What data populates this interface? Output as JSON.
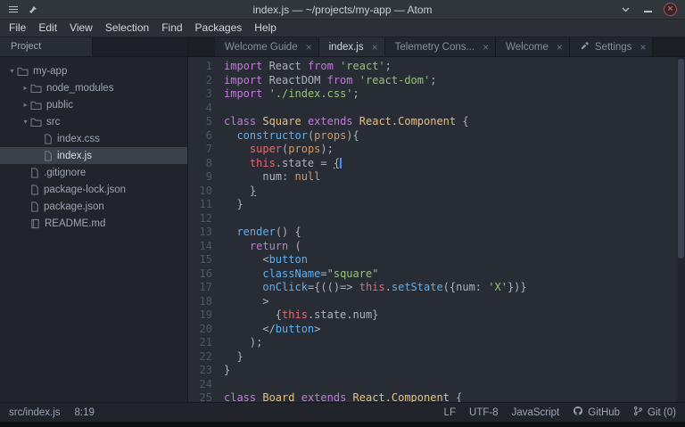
{
  "titlebar": {
    "title": "index.js — ~/projects/my-app — Atom",
    "left_icons": [
      "window-menu-icon",
      "pin-icon"
    ],
    "right_icons": [
      "shade-icon",
      "minimize-icon",
      "close-icon"
    ]
  },
  "menu": {
    "items": [
      "File",
      "Edit",
      "View",
      "Selection",
      "Find",
      "Packages",
      "Help"
    ]
  },
  "tree": {
    "header": "Project",
    "items": [
      {
        "label": "my-app",
        "type": "folder",
        "expanded": true,
        "indent": 0,
        "icon": "folder-icon"
      },
      {
        "label": "node_modules",
        "type": "folder",
        "expanded": false,
        "indent": 1,
        "icon": "folder-icon"
      },
      {
        "label": "public",
        "type": "folder",
        "expanded": false,
        "indent": 1,
        "icon": "folder-icon"
      },
      {
        "label": "src",
        "type": "folder",
        "expanded": true,
        "indent": 1,
        "icon": "folder-icon"
      },
      {
        "label": "index.css",
        "type": "file",
        "indent": 2,
        "icon": "file-icon"
      },
      {
        "label": "index.js",
        "type": "file",
        "indent": 2,
        "icon": "file-icon",
        "selected": true
      },
      {
        "label": ".gitignore",
        "type": "file",
        "indent": 1,
        "icon": "file-icon"
      },
      {
        "label": "package-lock.json",
        "type": "file",
        "indent": 1,
        "icon": "file-icon"
      },
      {
        "label": "package.json",
        "type": "file",
        "indent": 1,
        "icon": "file-icon"
      },
      {
        "label": "README.md",
        "type": "file",
        "indent": 1,
        "icon": "book-icon"
      }
    ]
  },
  "tabs": [
    {
      "label": "Welcome Guide",
      "active": false
    },
    {
      "label": "index.js",
      "active": true
    },
    {
      "label": "Telemetry Cons...",
      "active": false
    },
    {
      "label": "Welcome",
      "active": false
    },
    {
      "label": "Settings",
      "active": false,
      "icon": "wrench-icon"
    }
  ],
  "colors": {
    "syntax": {
      "kw": "#c678dd",
      "str": "#98c379",
      "cls": "#e5c07b",
      "fn": "#61afef",
      "red": "#e06c75",
      "orn": "#d19a66",
      "pln": "#abb2bf"
    },
    "editor_bg": "#282c34",
    "panel_bg": "#21252b",
    "selection_bg": "#3a404c"
  },
  "editor": {
    "lines": [
      {
        "n": 1,
        "s": [
          {
            "t": "import",
            "c": "kw"
          },
          {
            "t": " React "
          },
          {
            "t": "from",
            "c": "kw"
          },
          {
            "t": " "
          },
          {
            "t": "'react'",
            "c": "str"
          },
          {
            "t": ";"
          }
        ]
      },
      {
        "n": 2,
        "s": [
          {
            "t": "import",
            "c": "kw"
          },
          {
            "t": " ReactDOM "
          },
          {
            "t": "from",
            "c": "kw"
          },
          {
            "t": " "
          },
          {
            "t": "'react-dom'",
            "c": "str"
          },
          {
            "t": ";"
          }
        ]
      },
      {
        "n": 3,
        "s": [
          {
            "t": "import",
            "c": "kw"
          },
          {
            "t": " "
          },
          {
            "t": "'./index.css'",
            "c": "str"
          },
          {
            "t": ";"
          }
        ]
      },
      {
        "n": 4,
        "s": []
      },
      {
        "n": 5,
        "s": [
          {
            "t": "class",
            "c": "kw"
          },
          {
            "t": " "
          },
          {
            "t": "Square",
            "c": "cls"
          },
          {
            "t": " "
          },
          {
            "t": "extends",
            "c": "kw"
          },
          {
            "t": " "
          },
          {
            "t": "React.Component",
            "c": "cls"
          },
          {
            "t": " {"
          }
        ]
      },
      {
        "n": 6,
        "s": [
          {
            "t": "  "
          },
          {
            "t": "constructor",
            "c": "fn"
          },
          {
            "t": "("
          },
          {
            "t": "props",
            "c": "orn"
          },
          {
            "t": "){"
          }
        ]
      },
      {
        "n": 7,
        "s": [
          {
            "t": "    "
          },
          {
            "t": "super",
            "c": "red"
          },
          {
            "t": "("
          },
          {
            "t": "props",
            "c": "orn"
          },
          {
            "t": ");"
          }
        ]
      },
      {
        "n": 8,
        "s": [
          {
            "t": "    "
          },
          {
            "t": "this",
            "c": "red"
          },
          {
            "t": ".state = "
          },
          {
            "t": "{",
            "u": true
          }
        ],
        "cursor": true
      },
      {
        "n": 9,
        "s": [
          {
            "t": "      num: "
          },
          {
            "t": "null",
            "c": "orn"
          }
        ]
      },
      {
        "n": 10,
        "s": [
          {
            "t": "    "
          },
          {
            "t": "}",
            "u": true
          }
        ]
      },
      {
        "n": 11,
        "s": [
          {
            "t": "  }"
          }
        ]
      },
      {
        "n": 12,
        "s": []
      },
      {
        "n": 13,
        "s": [
          {
            "t": "  "
          },
          {
            "t": "render",
            "c": "fn"
          },
          {
            "t": "() {"
          }
        ]
      },
      {
        "n": 14,
        "s": [
          {
            "t": "    "
          },
          {
            "t": "return",
            "c": "kw"
          },
          {
            "t": " ("
          }
        ]
      },
      {
        "n": 15,
        "s": [
          {
            "t": "      <"
          },
          {
            "t": "button",
            "c": "fn"
          }
        ]
      },
      {
        "n": 16,
        "s": [
          {
            "t": "      "
          },
          {
            "t": "className",
            "c": "fn"
          },
          {
            "t": "="
          },
          {
            "t": "\"square\"",
            "c": "str"
          }
        ]
      },
      {
        "n": 17,
        "s": [
          {
            "t": "      "
          },
          {
            "t": "onClick",
            "c": "fn"
          },
          {
            "t": "={(()=> "
          },
          {
            "t": "this",
            "c": "red"
          },
          {
            "t": "."
          },
          {
            "t": "setState",
            "c": "fn"
          },
          {
            "t": "({num: "
          },
          {
            "t": "'X'",
            "c": "str"
          },
          {
            "t": "})}"
          }
        ]
      },
      {
        "n": 18,
        "s": [
          {
            "t": "      >"
          }
        ]
      },
      {
        "n": 19,
        "s": [
          {
            "t": "        {"
          },
          {
            "t": "this",
            "c": "red"
          },
          {
            "t": ".state.num}"
          }
        ]
      },
      {
        "n": 20,
        "s": [
          {
            "t": "      </"
          },
          {
            "t": "button",
            "c": "fn"
          },
          {
            "t": ">"
          }
        ]
      },
      {
        "n": 21,
        "s": [
          {
            "t": "    );"
          }
        ]
      },
      {
        "n": 22,
        "s": [
          {
            "t": "  }"
          }
        ]
      },
      {
        "n": 23,
        "s": [
          {
            "t": "}"
          }
        ]
      },
      {
        "n": 24,
        "s": []
      },
      {
        "n": 25,
        "s": [
          {
            "t": "class",
            "c": "kw"
          },
          {
            "t": " "
          },
          {
            "t": "Board",
            "c": "cls"
          },
          {
            "t": " "
          },
          {
            "t": "extends",
            "c": "kw"
          },
          {
            "t": " "
          },
          {
            "t": "React.Component",
            "c": "cls"
          },
          {
            "t": " {"
          }
        ]
      }
    ]
  },
  "statusbar": {
    "file": "src/index.js",
    "position": "8:19",
    "line_ending": "LF",
    "encoding": "UTF-8",
    "grammar": "JavaScript",
    "github_label": "GitHub",
    "git_label": "Git (0)"
  }
}
